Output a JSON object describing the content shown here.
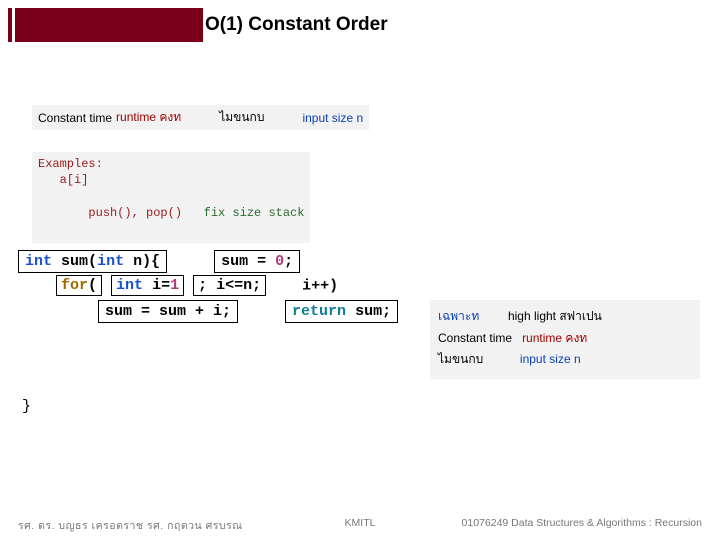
{
  "title": "O(1)   Constant Order",
  "constant_row": {
    "label": "Constant time",
    "runtime": "runtime คงท",
    "th1": "ไมขนกบ",
    "input": "input size n"
  },
  "examples": {
    "header": "Examples:",
    "line1": "   a[i]",
    "line2_a": "   push(), pop()   ",
    "line2_b": "fix size stack"
  },
  "code": {
    "kw_int": "int",
    "sum": "sum",
    "paren_open": "(",
    "n_param": "n){",
    "eq0": " = ",
    "zero": "0",
    "semi": ";",
    "for": "for",
    "open": "(",
    "i_eq": " i=",
    "one": "1",
    "cond": " ; i<=n;",
    "inc": "i++)",
    "body_a": "sum = sum + i;",
    "ret": "return",
    "ret_b": " sum;",
    "close_brace": "}"
  },
  "right": {
    "r1a": "เฉพาะท",
    "r1b": "high light สฟาเปน",
    "r2a": "Constant time",
    "r2b": "runtime คงท",
    "r3a": "ไมขนกบ",
    "r3b": "input size n"
  },
  "footer": {
    "left": "รศ. ดร. บญธร     เครอตราช       รศ. กฤตวน  ศรบรณ",
    "mid": "KMITL",
    "right": "01076249 Data Structures & Algorithms : Recursion"
  }
}
